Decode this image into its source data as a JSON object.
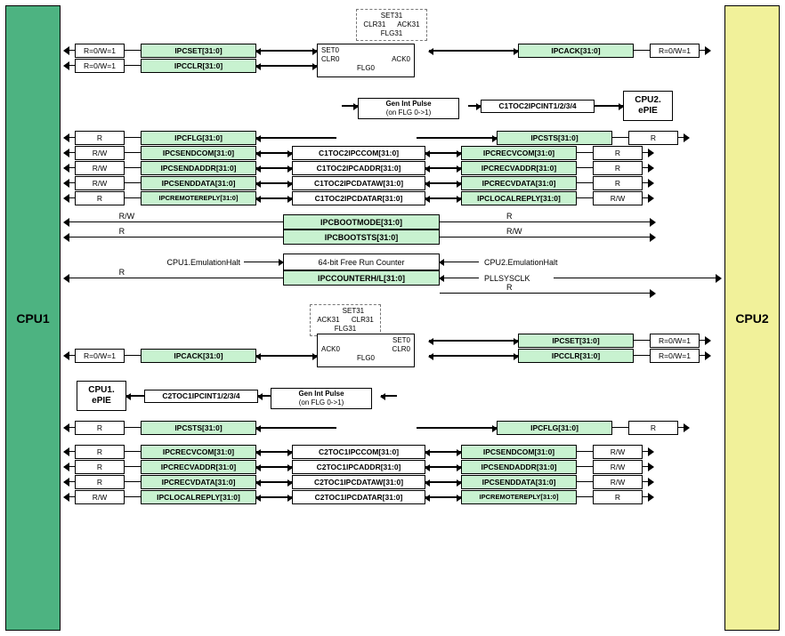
{
  "cpu1": {
    "label": "CPU1"
  },
  "cpu2": {
    "label": "CPU2"
  },
  "rw": {
    "r0w1": "R=0/W=1",
    "r": "R",
    "rw": "R/W"
  },
  "c1": {
    "ipcset": "IPCSET[31:0]",
    "ipcclr": "IPCCLR[31:0]",
    "ipcack": "IPCACK[31:0]",
    "ipcflg": "IPCFLG[31:0]",
    "ipcsts": "IPCSTS[31:0]",
    "sendcom": "IPCSENDCOM[31:0]",
    "sendaddr": "IPCSENDADDR[31:0]",
    "senddata": "IPCSENDDATA[31:0]",
    "remotereply": "IPCREMOTEREPLY[31:0]",
    "recvcom": "IPCRECVCOM[31:0]",
    "recvaddr": "IPCRECVADDR[31:0]",
    "recvdata": "IPCRECVDATA[31:0]",
    "localreply": "IPCLOCALREPLY[31:0]",
    "com": "C1TOC2IPCCOM[31:0]",
    "addr": "C1TOC2IPCADDR[31:0]",
    "dataw": "C1TOC2IPCDATAW[31:0]",
    "datar": "C1TOC2IPCDATAR[31:0]",
    "intsig": "C1TOC2IPCINT1/2/3/4",
    "epie": "CPU2.\nePIE"
  },
  "c2": {
    "com": "C2TOC1IPCCOM[31:0]",
    "addr": "C2TOC1IPCADDR[31:0]",
    "dataw": "C2TOC1IPCDATAW[31:0]",
    "datar": "C2TOC1IPCDATAR[31:0]",
    "intsig": "C2TOC1IPCINT1/2/3/4",
    "epie": "CPU1.\nePIE"
  },
  "shared": {
    "bootmode": "IPCBOOTMODE[31:0]",
    "bootsts": "IPCBOOTSTS[31:0]",
    "counterlbl": "64-bit Free Run Counter",
    "counter": "IPCCOUNTERH/L[31:0]",
    "emu1": "CPU1.EmulationHalt",
    "emu2": "CPU2.EmulationHalt",
    "pll": "PLLSYSCLK"
  },
  "flg": {
    "set31": "SET31",
    "clr31": "CLR31",
    "ack31": "ACK31",
    "flg31": "FLG31",
    "set0": "SET0",
    "clr0": "CLR0",
    "ack0": "ACK0",
    "flg0": "FLG0"
  },
  "genint": {
    "title": "Gen Int Pulse",
    "sub": "(on FLG 0->1)"
  }
}
